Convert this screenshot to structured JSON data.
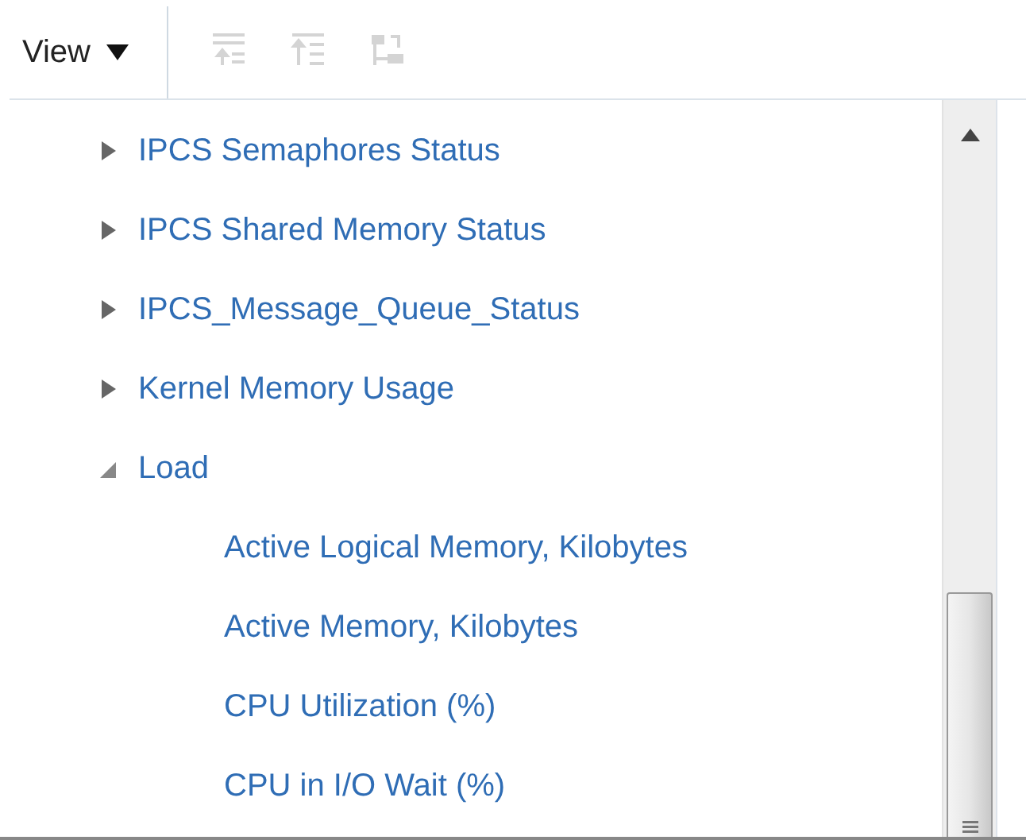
{
  "toolbar": {
    "view_menu": {
      "label": "View"
    }
  },
  "tree": [
    {
      "label": "IPCS Semaphores Status",
      "expanded": false
    },
    {
      "label": "IPCS Shared Memory Status",
      "expanded": false
    },
    {
      "label": "IPCS_Message_Queue_Status",
      "expanded": false
    },
    {
      "label": "Kernel Memory Usage",
      "expanded": false
    },
    {
      "label": "Load",
      "expanded": true,
      "children": [
        {
          "label": "Active Logical Memory, Kilobytes"
        },
        {
          "label": "Active Memory, Kilobytes"
        },
        {
          "label": "CPU Utilization (%)"
        },
        {
          "label": "CPU in I/O Wait (%)"
        }
      ]
    }
  ]
}
